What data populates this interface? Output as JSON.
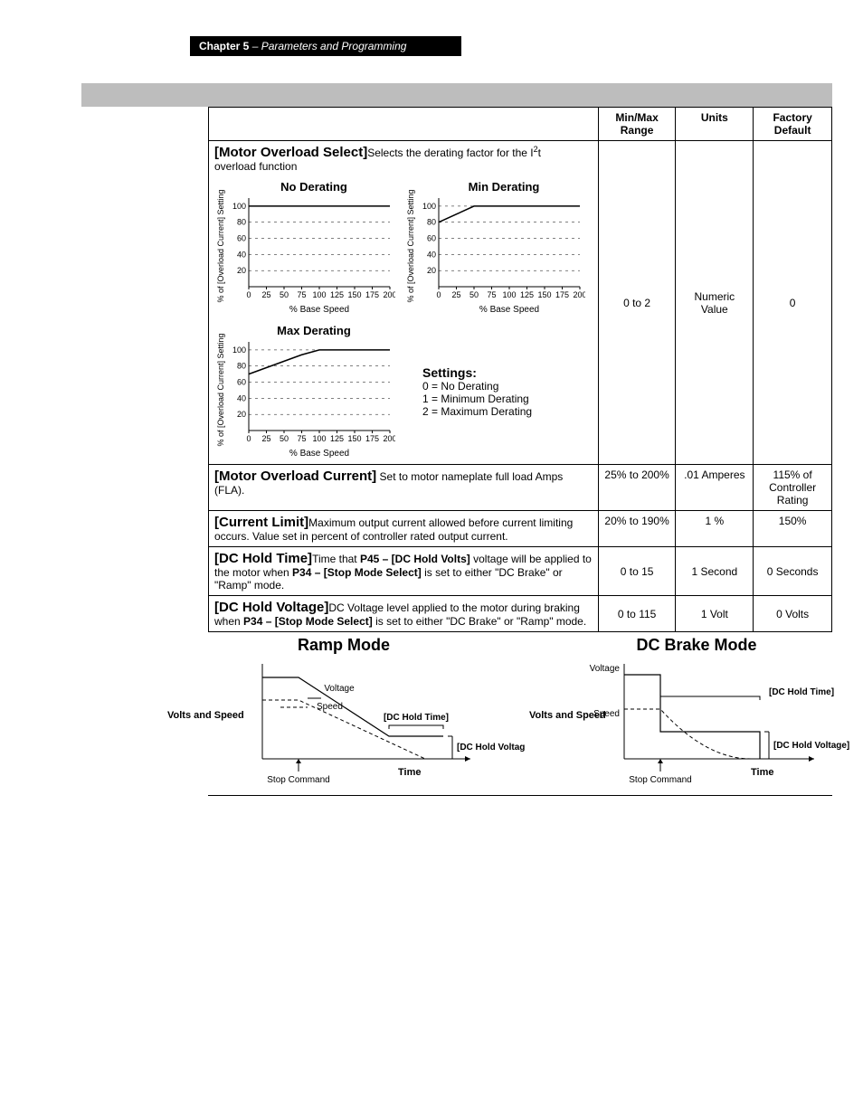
{
  "chapter": {
    "prefix": "Chapter 5",
    "suffix": " – Parameters and Programming"
  },
  "table": {
    "headers": {
      "minmax": "Min/Max Range",
      "units": "Units",
      "default": "Factory Default"
    },
    "rows": {
      "overload_select": {
        "name": "[Motor Overload Select]",
        "desc1": "Selects the derating factor for the I",
        "desc1_sup": "2",
        "desc1_tail": "t",
        "desc2": "overload function",
        "range": "0 to 2",
        "units": "Numeric Value",
        "default": "0",
        "settings": {
          "title": "Settings:",
          "opt0": "0 = No Derating",
          "opt1": "1 = Minimum Derating",
          "opt2": "2 = Maximum Derating"
        },
        "chart_titles": {
          "no": "No Derating",
          "min": "Min Derating",
          "max": "Max Derating"
        }
      },
      "overload_current": {
        "name": "[Motor Overload Current]",
        "desc": " Set to motor nameplate full load Amps (FLA).",
        "range": "25% to 200%",
        "units": ".01 Amperes",
        "default": "115% of Controller Rating"
      },
      "current_limit": {
        "name": "[Current Limit]",
        "desc": "Maximum output current allowed before current limiting occurs.  Value set in percent of controller rated output current.",
        "range": "20% to 190%",
        "units": "1 %",
        "default": "150%"
      },
      "dc_hold_time": {
        "name": "[DC Hold Time]",
        "desc_pre": "Time that ",
        "desc_p45": "P45 – [DC Hold Volts]",
        "desc_mid": " voltage will be applied to the motor when ",
        "desc_p34": "P34 – [Stop Mode Select]",
        "desc_post": " is set to either \"DC Brake\" or \"Ramp\" mode.",
        "range": "0 to 15",
        "units": "1 Second",
        "default": "0 Seconds"
      },
      "dc_hold_voltage": {
        "name": "[DC Hold Voltage]",
        "desc_pre": "DC Voltage level applied to the motor during braking when ",
        "desc_p34": "P34 – [Stop Mode Select]",
        "desc_post": " is set to either \"DC Brake\" or \"Ramp\" mode.",
        "range": "0 to 115",
        "units": "1 Volt",
        "default": "0 Volts"
      }
    }
  },
  "bottom": {
    "ramp_title": "Ramp Mode",
    "brake_title": "DC Brake Mode",
    "labels": {
      "volts_speed": "Volts and Speed",
      "voltage": "Voltage",
      "speed": "Speed",
      "dc_hold_time": "[DC Hold Time]",
      "dc_hold_voltage": "[DC Hold Voltage]",
      "time": "Time",
      "stop_command": "Stop Command"
    }
  },
  "chart_axes": {
    "xlabel": "% Base Speed",
    "ylabel": "% of [Overload Current] Setting",
    "xticks": [
      "0",
      "25",
      "50",
      "75",
      "100",
      "125",
      "150",
      "175",
      "200"
    ],
    "yticks": [
      "20",
      "40",
      "60",
      "80",
      "100"
    ]
  },
  "chart_data": [
    {
      "type": "line",
      "title": "No Derating",
      "xlabel": "% Base Speed",
      "ylabel": "% of [Overload Current] Setting",
      "xlim": [
        0,
        200
      ],
      "ylim": [
        0,
        110
      ],
      "x": [
        0,
        25,
        50,
        75,
        100,
        125,
        150,
        175,
        200
      ],
      "values": [
        100,
        100,
        100,
        100,
        100,
        100,
        100,
        100,
        100
      ]
    },
    {
      "type": "line",
      "title": "Min Derating",
      "xlabel": "% Base Speed",
      "ylabel": "% of [Overload Current] Setting",
      "xlim": [
        0,
        200
      ],
      "ylim": [
        0,
        110
      ],
      "x": [
        0,
        25,
        50,
        75,
        100,
        125,
        150,
        175,
        200
      ],
      "values": [
        80,
        90,
        100,
        100,
        100,
        100,
        100,
        100,
        100
      ]
    },
    {
      "type": "line",
      "title": "Max Derating",
      "xlabel": "% Base Speed",
      "ylabel": "% of [Overload Current] Setting",
      "xlim": [
        0,
        200
      ],
      "ylim": [
        0,
        110
      ],
      "x": [
        0,
        25,
        50,
        75,
        100,
        125,
        150,
        175,
        200
      ],
      "values": [
        70,
        78,
        86,
        94,
        100,
        100,
        100,
        100,
        100
      ]
    }
  ]
}
